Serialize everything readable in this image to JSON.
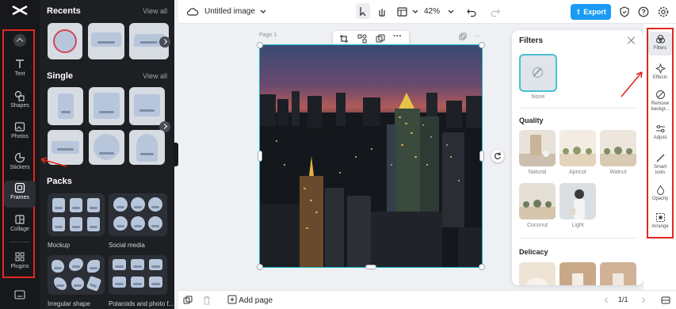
{
  "colors": {
    "accent": "#1a9cf4",
    "highlight": "#e0281e",
    "selection": "#19b6c9",
    "dark_bg": "#1d1f23"
  },
  "rail": {
    "items": [
      {
        "label": "Text",
        "icon": "text-icon"
      },
      {
        "label": "Shapes",
        "icon": "shapes-icon"
      },
      {
        "label": "Photos",
        "icon": "photos-icon"
      },
      {
        "label": "Stickers",
        "icon": "stickers-icon"
      },
      {
        "label": "Frames",
        "icon": "frames-icon"
      },
      {
        "label": "Collage",
        "icon": "collage-icon"
      },
      {
        "label": "Plugins",
        "icon": "plugins-icon"
      }
    ],
    "active": "Frames"
  },
  "assets": {
    "recents_title": "Recents",
    "recents_all": "View all",
    "single_title": "Single",
    "single_all": "View all",
    "packs_title": "Packs",
    "packs": [
      "Mockup",
      "Social media",
      "Irregular shape",
      "Polaroids and photo f..."
    ]
  },
  "topbar": {
    "title": "Untitled image",
    "zoom": "42%",
    "export_label": "Export"
  },
  "canvas": {
    "page_label": "Page 1"
  },
  "filters": {
    "title": "Filters",
    "none_label": "None",
    "sections": [
      {
        "title": "Quality",
        "items": [
          "Natural",
          "Apricot",
          "Walnut",
          "Coconut",
          "Light"
        ]
      },
      {
        "title": "Delicacy",
        "items": []
      }
    ]
  },
  "tools": [
    {
      "label": "Filters",
      "icon": "filters-icon"
    },
    {
      "label": "Effects",
      "icon": "effects-icon"
    },
    {
      "label": "Remove backgr...",
      "icon": "remove-background-icon"
    },
    {
      "label": "Adjust",
      "icon": "adjust-icon"
    },
    {
      "label": "Smart tools",
      "icon": "smart-tools-icon"
    },
    {
      "label": "Opacity",
      "icon": "opacity-icon"
    },
    {
      "label": "Arrange",
      "icon": "arrange-icon"
    }
  ],
  "bottombar": {
    "add_page": "Add page",
    "page_counter": "1/1"
  }
}
